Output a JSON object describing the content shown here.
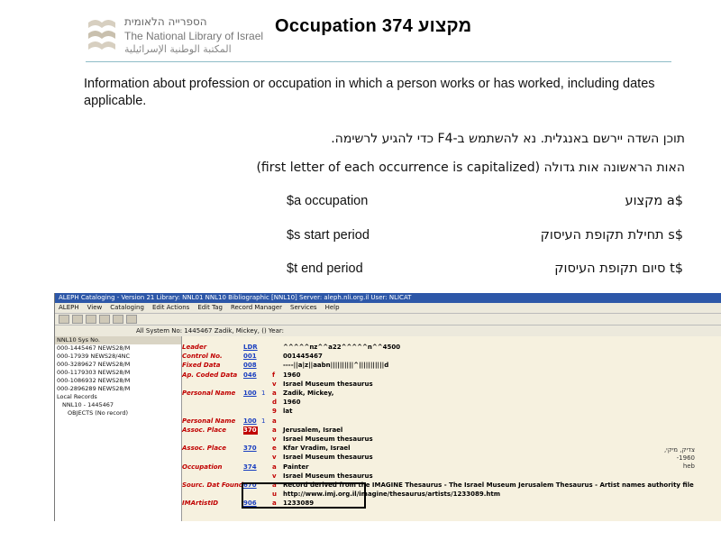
{
  "header": {
    "logo_line1": "הספרייה הלאומית",
    "logo_line2": "The National Library of Israel",
    "logo_line3": "المكتبة الوطنية الإسرائيلية",
    "title": "Occupation 374 מקצוע"
  },
  "description": "Information about profession or occupation in which a person works or has worked, including dates applicable.",
  "hebrew_note1": "תוכן השדה יירשם באנגלית. נא להשתמש ב-F4 כדי להגיע לרשימה.",
  "hebrew_note2": "האות הראשונה אות גדולה (first letter of each occurrence is capitalized)",
  "subfields": [
    {
      "en": "$a occupation",
      "he": "$a מקצוע"
    },
    {
      "en": "$s start period",
      "he": "$s תחילת תקופת העיסוק"
    },
    {
      "en": "$t end period",
      "he": "$t סיום תקופת העיסוק"
    }
  ],
  "screenshot": {
    "window_title": "ALEPH Cataloging - Version 21   Library: NNL01   NNL10 Bibliographic [NNL10]  Server: aleph.nli.org.il  User: NLICAT",
    "menu": [
      "ALEPH",
      "View",
      "Cataloging",
      "Edit Actions",
      "Edit Tag",
      "Record Manager",
      "Services",
      "Help"
    ],
    "record_bar": "All System No: 1445467 Zadik, Mickey, () Year:",
    "left_header": "NNL10 Sys No.",
    "left_items": [
      "000-1445467 NEWS28/M",
      "000-17939 NEWS28/4NC",
      "000-3289627 NEWS28/M",
      "000-1179303 NEWS28/M",
      "000-1086932 NEWS28/M",
      "000-2896289 NEWS28/M"
    ],
    "left_items2": [
      "Local Records",
      "NNL10 - 1445467",
      "OBJECTS (No record)"
    ],
    "fields": [
      {
        "label": "Leader",
        "tag": "LDR",
        "ind": "",
        "sub": "",
        "value": "^^^^^nz^^a22^^^^^n^^4500"
      },
      {
        "label": "Control No.",
        "tag": "001",
        "ind": "",
        "sub": "",
        "value": "001445467"
      },
      {
        "label": "Fixed Data",
        "tag": "008",
        "ind": "",
        "sub": "",
        "value": "----||a|z||aabn||||||||||^|||||||||||d"
      },
      {
        "label": "Ap. Coded Data",
        "tag": "046",
        "ind": "",
        "sub": "f",
        "value": "1960"
      },
      {
        "label": "",
        "tag": "",
        "ind": "",
        "sub": "v",
        "value": "Israel Museum thesaurus"
      },
      {
        "label": "Personal Name",
        "tag": "100",
        "ind": "1",
        "sub": "a",
        "value": "Zadik, Mickey,"
      },
      {
        "label": "",
        "tag": "",
        "ind": "",
        "sub": "d",
        "value": "1960"
      },
      {
        "label": "",
        "tag": "",
        "ind": "",
        "sub": "9",
        "value": "lat"
      },
      {
        "label": "Personal Name",
        "tag": "100",
        "ind": "1",
        "sub": "a",
        "value": ""
      },
      {
        "label": "Assoc. Place",
        "tag": "370",
        "ind": "",
        "sub": "a",
        "value": "Jerusalem, Israel"
      },
      {
        "label": "",
        "tag": "",
        "ind": "",
        "sub": "v",
        "value": "Israel Museum thesaurus"
      },
      {
        "label": "Assoc. Place",
        "tag": "370",
        "ind": "",
        "sub": "e",
        "value": "Kfar Vradim, Israel"
      },
      {
        "label": "",
        "tag": "",
        "ind": "",
        "sub": "v",
        "value": "Israel Museum thesaurus"
      },
      {
        "label": "Occupation",
        "tag": "374",
        "ind": "",
        "sub": "a",
        "value": "Painter"
      },
      {
        "label": "",
        "tag": "",
        "ind": "",
        "sub": "v",
        "value": "Israel Museum thesaurus"
      },
      {
        "label": "Sourc. Dat Found",
        "tag": "670",
        "ind": "",
        "sub": "a",
        "value": "Record derived from the IMAGINE Thesaurus - The Israel Museum Jerusalem Thesaurus - Artist names authority file"
      },
      {
        "label": "",
        "tag": "",
        "ind": "",
        "sub": "u",
        "value": "http://www.imj.org.il/imagine/thesaurus/artists/1233089.htm"
      },
      {
        "label": "IMArtistID",
        "tag": "906",
        "ind": "",
        "sub": "a",
        "value": "1233089"
      }
    ],
    "hebrew_name_lines": [
      "צדיק, מיקי,",
      "1960-",
      "heb"
    ]
  }
}
